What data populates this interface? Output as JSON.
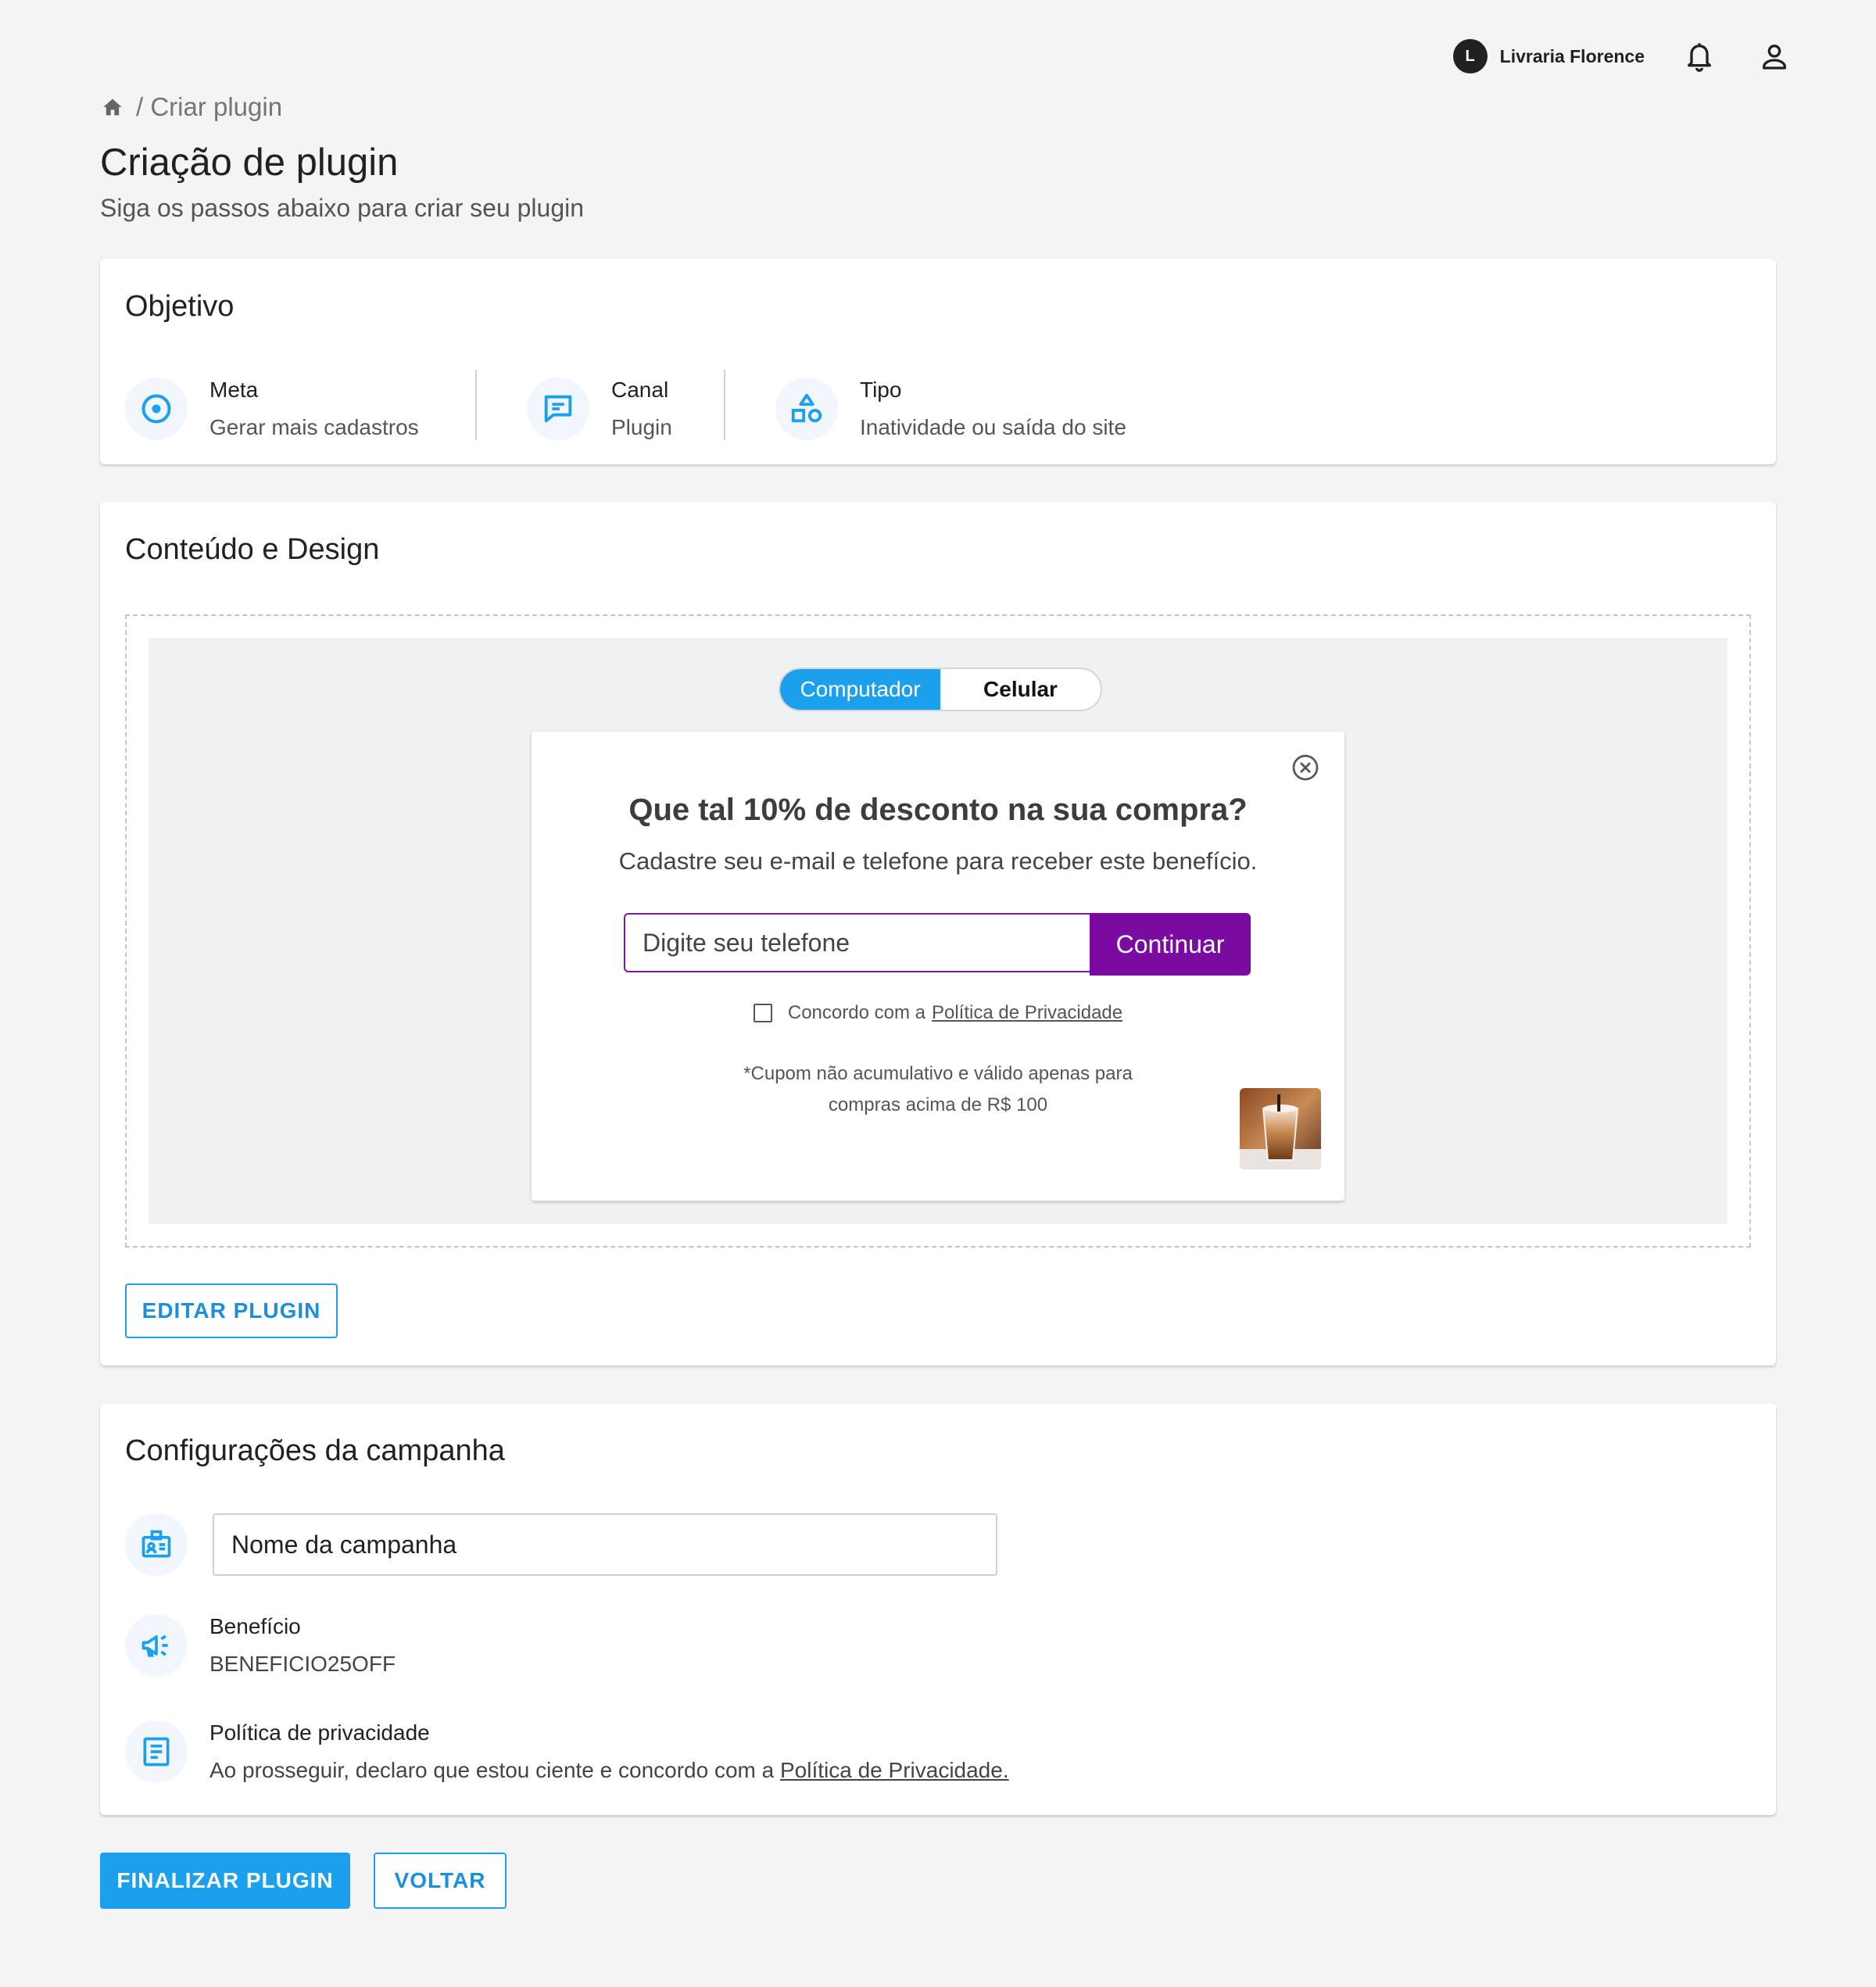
{
  "header": {
    "account_initial": "L",
    "account_name": "Livraria Florence",
    "icons": [
      "bell-icon",
      "user-icon"
    ]
  },
  "breadcrumb": {
    "separator_text": "/ Criar plugin",
    "icon": "home-icon"
  },
  "page": {
    "title": "Criação de plugin",
    "subtitle": "Siga os passos abaixo para criar seu plugin"
  },
  "objective": {
    "title": "Objetivo",
    "items": [
      {
        "label": "Meta",
        "value": "Gerar mais cadastros",
        "icon": "target-icon"
      },
      {
        "label": "Canal",
        "value": "Plugin",
        "icon": "chat-icon"
      },
      {
        "label": "Tipo",
        "value": "Inatividade ou saída do site",
        "icon": "shapes-icon"
      }
    ]
  },
  "content": {
    "title": "Conteúdo e Design",
    "toggle": {
      "desktop": "Computador",
      "mobile": "Celular",
      "selected": "Computador"
    },
    "popup": {
      "title": "Que tal 10% de desconto na sua compra?",
      "description": "Cadastre seu e-mail e telefone para receber este benefício.",
      "input_placeholder": "Digite seu telefone",
      "button": "Continuar",
      "consent_prefix": "Concordo com a",
      "consent_link": "Política de Privacidade",
      "coupon_line1": "*Cupom não acumulativo e válido apenas para",
      "coupon_line2": "compras acima de R$ 100",
      "image": "iced-coffee-thumbnail"
    },
    "edit_button": "EDITAR PLUGIN"
  },
  "config": {
    "title": "Configurações da campanha",
    "campaign_name_placeholder": "Nome da campanha",
    "benefit_label": "Benefício",
    "benefit_value": "BENEFICIO25OFF",
    "privacy_label": "Política de privacidade",
    "privacy_text": "Ao prosseguir, declaro que estou ciente e concordo com a",
    "privacy_link": "Política de Privacidade."
  },
  "actions": {
    "finish": "FINALIZAR PLUGIN",
    "back": "VOLTAR"
  },
  "colors": {
    "primary": "#1ba0ee",
    "popup_accent": "#7a0aa0",
    "background": "#f4f4f4"
  }
}
